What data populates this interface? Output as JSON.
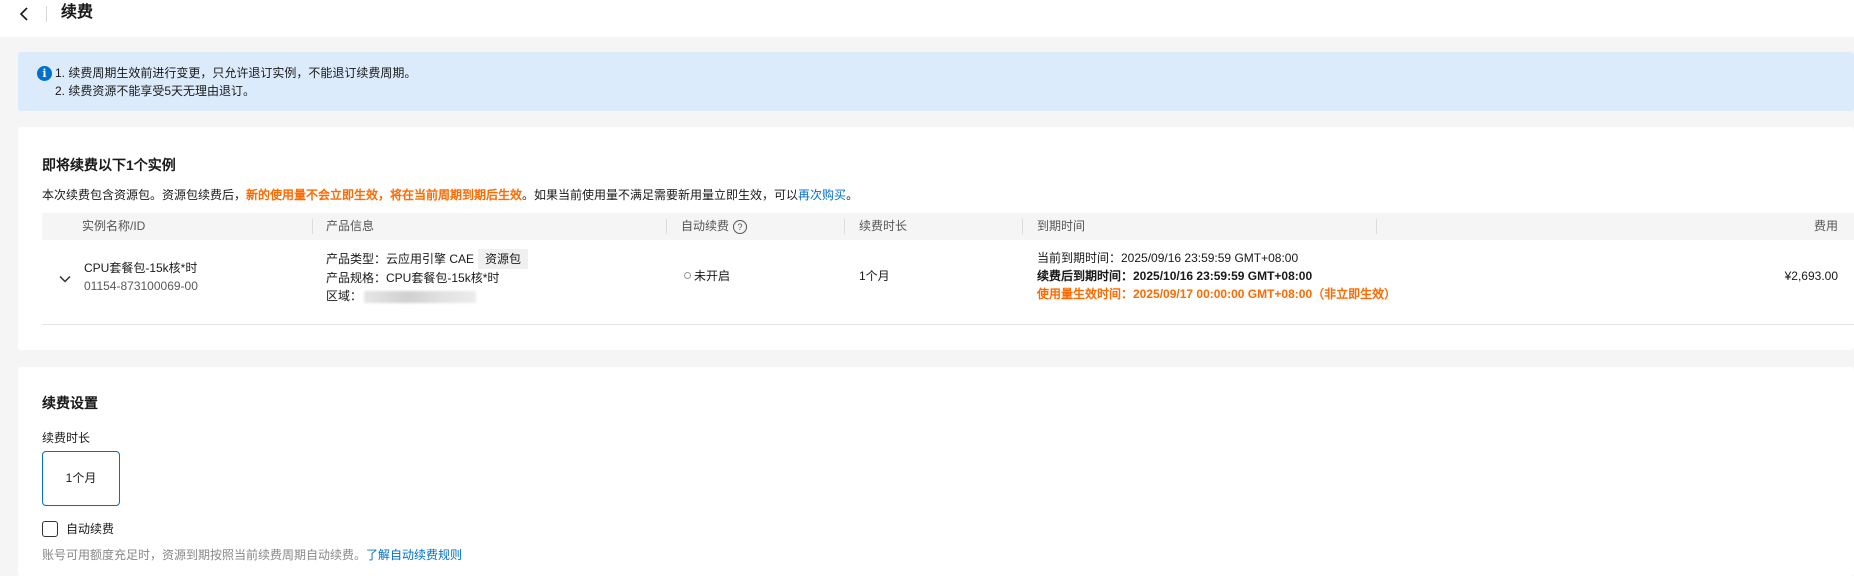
{
  "header": {
    "title": "续费"
  },
  "notice": {
    "line1": "1. 续费周期生效前进行变更，只允许退订实例，不能退订续费周期。",
    "line2": "2. 续费资源不能享受5天无理由退订。"
  },
  "instances": {
    "title": "即将续费以下1个实例",
    "desc_prefix": "本次续费包含资源包。资源包续费后，",
    "desc_highlight": "新的使用量不会立即生效，将在当前周期到期后生效",
    "desc_middle": "。如果当前使用量不满足需要新用量立即生效，可以",
    "desc_link": "再次购买",
    "desc_suffix": "。",
    "columns": [
      "实例名称/ID",
      "产品信息",
      "自动续费",
      "续费时长",
      "到期时间",
      "费用"
    ],
    "rows": [
      {
        "name": "CPU套餐包-15k核*时",
        "id": "01154-873100069-00",
        "product_type_label": "产品类型：",
        "product_type": "云应用引擎 CAE",
        "product_tag": "资源包",
        "spec_label": "产品规格：",
        "spec": "CPU套餐包-15k核*时",
        "region_label": "区域：",
        "auto_renew": "未开启",
        "duration": "1个月",
        "current_expiry": "当前到期时间：2025/09/16 23:59:59 GMT+08:00",
        "new_expiry": "续费后到期时间：2025/10/16 23:59:59 GMT+08:00",
        "effective_time": "使用量生效时间：2025/09/17 00:00:00 GMT+08:00（非立即生效）",
        "cost": "¥2,693.00"
      }
    ]
  },
  "settings": {
    "title": "续费设置",
    "duration_label": "续费时长",
    "duration_option": "1个月",
    "auto_renew_label": "自动续费",
    "hint_text": "账号可用额度充足时，资源到期按照当前续费周期自动续费。",
    "hint_link": "了解自动续费规则"
  },
  "colors": {
    "accent": "#0070cc",
    "highlight": "#ff6a00",
    "notice_bg": "#dcebfc"
  }
}
